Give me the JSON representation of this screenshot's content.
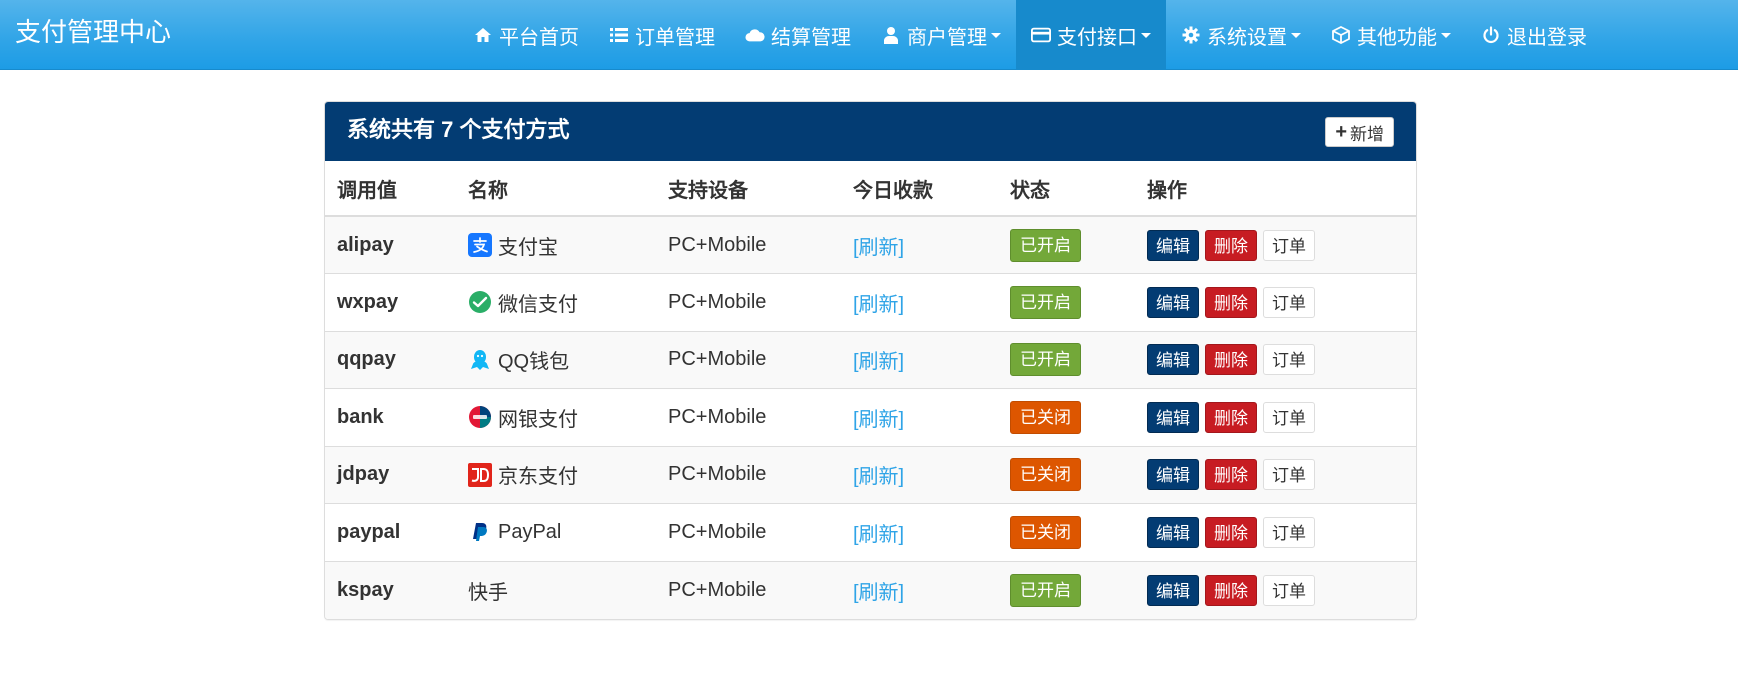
{
  "brand": "支付管理中心",
  "nav": [
    {
      "label": "平台首页",
      "icon": "home-icon"
    },
    {
      "label": "订单管理",
      "icon": "list-icon"
    },
    {
      "label": "结算管理",
      "icon": "cloud-icon"
    },
    {
      "label": "商户管理",
      "icon": "user-icon",
      "dropdown": true
    },
    {
      "label": "支付接口",
      "icon": "credit-card-icon",
      "dropdown": true,
      "active": true
    },
    {
      "label": "系统设置",
      "icon": "gear-icon",
      "dropdown": true
    },
    {
      "label": "其他功能",
      "icon": "cube-icon",
      "dropdown": true
    },
    {
      "label": "退出登录",
      "icon": "power-icon"
    }
  ],
  "panel": {
    "title": "系统共有 7 个支付方式",
    "add_label": "新增"
  },
  "table": {
    "headers": [
      "调用值",
      "名称",
      "支持设备",
      "今日收款",
      "状态",
      "操作"
    ],
    "rows": [
      {
        "code": "alipay",
        "name": "支付宝",
        "icon": "alipay-icon",
        "device": "PC+Mobile",
        "income": "[刷新]",
        "status": "已开启",
        "enabled": true
      },
      {
        "code": "wxpay",
        "name": "微信支付",
        "icon": "wechat-pay-icon",
        "device": "PC+Mobile",
        "income": "[刷新]",
        "status": "已开启",
        "enabled": true
      },
      {
        "code": "qqpay",
        "name": "QQ钱包",
        "icon": "qq-icon",
        "device": "PC+Mobile",
        "income": "[刷新]",
        "status": "已开启",
        "enabled": true
      },
      {
        "code": "bank",
        "name": "网银支付",
        "icon": "unionpay-icon",
        "device": "PC+Mobile",
        "income": "[刷新]",
        "status": "已关闭",
        "enabled": false
      },
      {
        "code": "jdpay",
        "name": "京东支付",
        "icon": "jd-icon",
        "device": "PC+Mobile",
        "income": "[刷新]",
        "status": "已关闭",
        "enabled": false
      },
      {
        "code": "paypal",
        "name": "PayPal",
        "icon": "paypal-icon",
        "device": "PC+Mobile",
        "income": "[刷新]",
        "status": "已关闭",
        "enabled": false
      },
      {
        "code": "kspay",
        "name": "快手",
        "icon": "",
        "device": "PC+Mobile",
        "income": "[刷新]",
        "status": "已开启",
        "enabled": true
      }
    ],
    "actions": {
      "edit": "编辑",
      "delete": "删除",
      "order": "订单"
    }
  },
  "colors": {
    "navbar": "#2fa4e7",
    "nav_active": "#178acc",
    "panel_heading": "#033c73",
    "status_on": "#73a839",
    "status_off": "#dd5600",
    "edit_button": "#033c73",
    "delete_button": "#c71c22",
    "link": "#2fa4e7"
  }
}
